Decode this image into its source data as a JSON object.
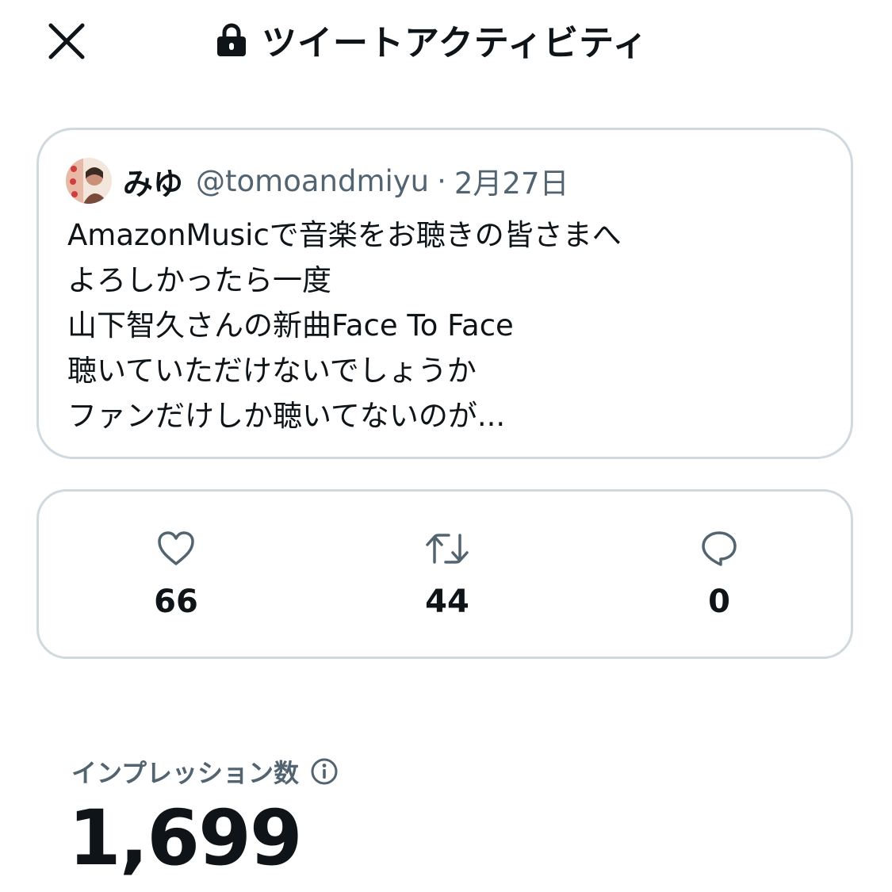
{
  "header": {
    "title": "ツイートアクティビティ",
    "close_icon": "close-icon",
    "lock_icon": "lock-icon"
  },
  "tweet": {
    "author_name": "みゆ",
    "handle": "@tomoandmiyu",
    "separator": "·",
    "date": "2月27日",
    "lines": [
      "AmazonMusicで音楽をお聴きの皆さまへ",
      "よろしかったら一度",
      "山下智久さんの新曲Face To Face",
      "聴いていただけないでしょうか",
      "ファンだけしか聴いてないのが..."
    ]
  },
  "stats": {
    "likes": "66",
    "retweets": "44",
    "replies": "0",
    "icons": [
      "heart-icon",
      "retweet-icon",
      "reply-icon"
    ]
  },
  "impressions": {
    "label": "インプレッション数",
    "value": "1,699",
    "info_icon": "info-icon"
  },
  "colors": {
    "text_primary": "#0f1419",
    "text_secondary": "#536471",
    "border": "#cfd9de"
  }
}
